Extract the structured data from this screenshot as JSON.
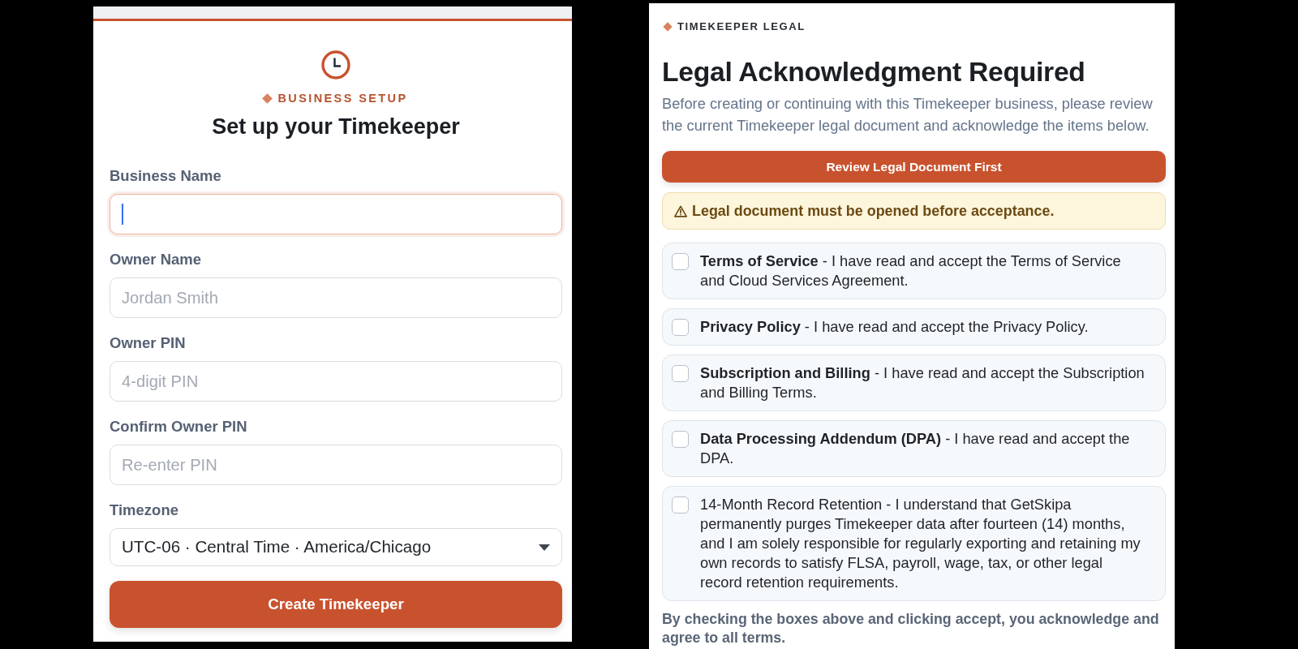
{
  "setup": {
    "eyebrow": "BUSINESS SETUP",
    "title": "Set up your Timekeeper",
    "fields": [
      {
        "kind": "text",
        "label": "Business Name",
        "focused": true
      },
      {
        "kind": "text",
        "label": "Owner Name",
        "placeholder": "Jordan Smith",
        "focused": false
      },
      {
        "kind": "text",
        "label": "Owner PIN",
        "placeholder": "4-digit PIN",
        "focused": false
      },
      {
        "kind": "text",
        "label": "Confirm Owner PIN",
        "placeholder": "Re-enter PIN",
        "focused": false
      },
      {
        "kind": "select",
        "label": "Timezone",
        "value": "UTC-06 · Central Time · America/Chicago",
        "focused": false
      }
    ],
    "submit": "Create Timekeeper"
  },
  "legal": {
    "eyebrow": "TIMEKEEPER LEGAL",
    "title": "Legal Acknowledgment Required",
    "intro": "Before creating or continuing with this Timekeeper business, please review the current Timekeeper legal document and acknowledge the items below.",
    "review_button": "Review Legal Document First",
    "warning": "Legal document must be opened before acceptance.",
    "items": [
      {
        "text": "**Terms of Service** - I have read and accept the Terms of Service and Cloud Services Agreement.",
        "checked": false
      },
      {
        "text": "**Privacy Policy** - I have read and accept the Privacy Policy.",
        "checked": false
      },
      {
        "text": "**Subscription and Billing** - I have read and accept the Subscription and Billing Terms.",
        "checked": false
      },
      {
        "text": "**Data Processing Addendum (DPA)** - I have read and accept the DPA.",
        "checked": false
      },
      {
        "text": "14-Month Record Retention - I understand that GetSkipa permanently purges Timekeeper data after fourteen (14) months, and I am solely responsible for regularly exporting and retaining my own records to satisfy FLSA, payroll, wage, tax, or other legal record retention requirements.",
        "checked": false
      }
    ],
    "footer": "By checking the boxes above and clicking accept, you acknowledge and agree to all terms."
  }
}
